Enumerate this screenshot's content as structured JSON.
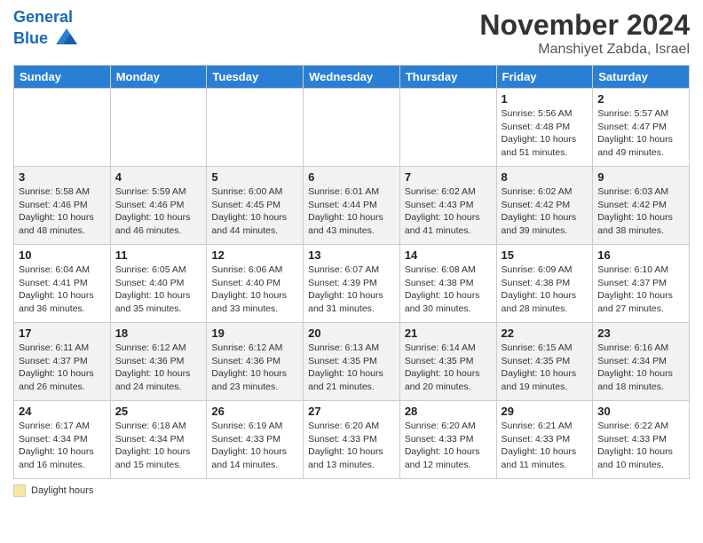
{
  "header": {
    "logo_line1": "General",
    "logo_line2": "Blue",
    "month_title": "November 2024",
    "location": "Manshiyet Zabda, Israel"
  },
  "legend": {
    "label": "Daylight hours"
  },
  "weekdays": [
    "Sunday",
    "Monday",
    "Tuesday",
    "Wednesday",
    "Thursday",
    "Friday",
    "Saturday"
  ],
  "weeks": [
    [
      {
        "day": "",
        "info": ""
      },
      {
        "day": "",
        "info": ""
      },
      {
        "day": "",
        "info": ""
      },
      {
        "day": "",
        "info": ""
      },
      {
        "day": "",
        "info": ""
      },
      {
        "day": "1",
        "info": "Sunrise: 5:56 AM\nSunset: 4:48 PM\nDaylight: 10 hours and 51 minutes."
      },
      {
        "day": "2",
        "info": "Sunrise: 5:57 AM\nSunset: 4:47 PM\nDaylight: 10 hours and 49 minutes."
      }
    ],
    [
      {
        "day": "3",
        "info": "Sunrise: 5:58 AM\nSunset: 4:46 PM\nDaylight: 10 hours and 48 minutes."
      },
      {
        "day": "4",
        "info": "Sunrise: 5:59 AM\nSunset: 4:46 PM\nDaylight: 10 hours and 46 minutes."
      },
      {
        "day": "5",
        "info": "Sunrise: 6:00 AM\nSunset: 4:45 PM\nDaylight: 10 hours and 44 minutes."
      },
      {
        "day": "6",
        "info": "Sunrise: 6:01 AM\nSunset: 4:44 PM\nDaylight: 10 hours and 43 minutes."
      },
      {
        "day": "7",
        "info": "Sunrise: 6:02 AM\nSunset: 4:43 PM\nDaylight: 10 hours and 41 minutes."
      },
      {
        "day": "8",
        "info": "Sunrise: 6:02 AM\nSunset: 4:42 PM\nDaylight: 10 hours and 39 minutes."
      },
      {
        "day": "9",
        "info": "Sunrise: 6:03 AM\nSunset: 4:42 PM\nDaylight: 10 hours and 38 minutes."
      }
    ],
    [
      {
        "day": "10",
        "info": "Sunrise: 6:04 AM\nSunset: 4:41 PM\nDaylight: 10 hours and 36 minutes."
      },
      {
        "day": "11",
        "info": "Sunrise: 6:05 AM\nSunset: 4:40 PM\nDaylight: 10 hours and 35 minutes."
      },
      {
        "day": "12",
        "info": "Sunrise: 6:06 AM\nSunset: 4:40 PM\nDaylight: 10 hours and 33 minutes."
      },
      {
        "day": "13",
        "info": "Sunrise: 6:07 AM\nSunset: 4:39 PM\nDaylight: 10 hours and 31 minutes."
      },
      {
        "day": "14",
        "info": "Sunrise: 6:08 AM\nSunset: 4:38 PM\nDaylight: 10 hours and 30 minutes."
      },
      {
        "day": "15",
        "info": "Sunrise: 6:09 AM\nSunset: 4:38 PM\nDaylight: 10 hours and 28 minutes."
      },
      {
        "day": "16",
        "info": "Sunrise: 6:10 AM\nSunset: 4:37 PM\nDaylight: 10 hours and 27 minutes."
      }
    ],
    [
      {
        "day": "17",
        "info": "Sunrise: 6:11 AM\nSunset: 4:37 PM\nDaylight: 10 hours and 26 minutes."
      },
      {
        "day": "18",
        "info": "Sunrise: 6:12 AM\nSunset: 4:36 PM\nDaylight: 10 hours and 24 minutes."
      },
      {
        "day": "19",
        "info": "Sunrise: 6:12 AM\nSunset: 4:36 PM\nDaylight: 10 hours and 23 minutes."
      },
      {
        "day": "20",
        "info": "Sunrise: 6:13 AM\nSunset: 4:35 PM\nDaylight: 10 hours and 21 minutes."
      },
      {
        "day": "21",
        "info": "Sunrise: 6:14 AM\nSunset: 4:35 PM\nDaylight: 10 hours and 20 minutes."
      },
      {
        "day": "22",
        "info": "Sunrise: 6:15 AM\nSunset: 4:35 PM\nDaylight: 10 hours and 19 minutes."
      },
      {
        "day": "23",
        "info": "Sunrise: 6:16 AM\nSunset: 4:34 PM\nDaylight: 10 hours and 18 minutes."
      }
    ],
    [
      {
        "day": "24",
        "info": "Sunrise: 6:17 AM\nSunset: 4:34 PM\nDaylight: 10 hours and 16 minutes."
      },
      {
        "day": "25",
        "info": "Sunrise: 6:18 AM\nSunset: 4:34 PM\nDaylight: 10 hours and 15 minutes."
      },
      {
        "day": "26",
        "info": "Sunrise: 6:19 AM\nSunset: 4:33 PM\nDaylight: 10 hours and 14 minutes."
      },
      {
        "day": "27",
        "info": "Sunrise: 6:20 AM\nSunset: 4:33 PM\nDaylight: 10 hours and 13 minutes."
      },
      {
        "day": "28",
        "info": "Sunrise: 6:20 AM\nSunset: 4:33 PM\nDaylight: 10 hours and 12 minutes."
      },
      {
        "day": "29",
        "info": "Sunrise: 6:21 AM\nSunset: 4:33 PM\nDaylight: 10 hours and 11 minutes."
      },
      {
        "day": "30",
        "info": "Sunrise: 6:22 AM\nSunset: 4:33 PM\nDaylight: 10 hours and 10 minutes."
      }
    ]
  ]
}
